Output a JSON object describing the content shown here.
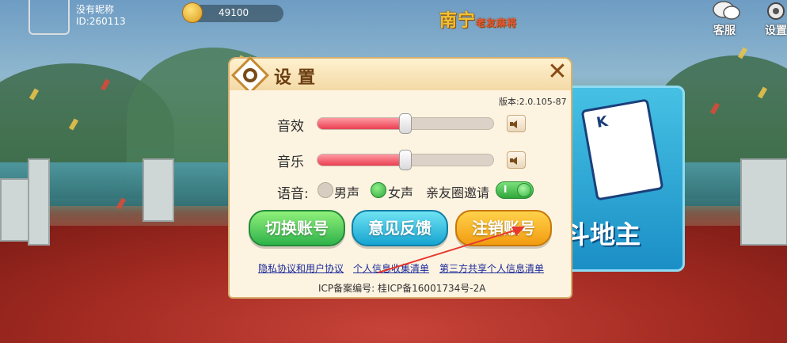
{
  "user": {
    "nickname": "没有昵称",
    "id_text": "ID:260113",
    "coins": "49100"
  },
  "header": {
    "logo_main": "南宁",
    "logo_sub": "老友麻将",
    "service_label": "客服",
    "settings_label": "设置"
  },
  "game_card": {
    "title": "斗地主",
    "card_rank": "K"
  },
  "dialog": {
    "title": "设置",
    "close_symbol": "✕",
    "version": "版本:2.0.105-87",
    "sound_effects_label": "音效",
    "sound_effects_level": 0.5,
    "music_label": "音乐",
    "music_level": 0.5,
    "voice_label": "语音:",
    "male_voice_label": "男声",
    "female_voice_label": "女声",
    "selected_voice": "女声",
    "friend_invite_label": "亲友圈邀请",
    "friend_invite_on": true,
    "toggle_text": "I",
    "buttons": {
      "switch_account": "切换账号",
      "feedback": "意见反馈",
      "cancel_account": "注销账号"
    },
    "links": {
      "privacy": "隐私协议和用户协议",
      "personal_info": "个人信息收集清单",
      "third_party": "第三方共享个人信息清单"
    },
    "icp": "ICP备案编号:  桂ICP备16001734号-2A"
  },
  "colors": {
    "slider_fill": "#ea3f52",
    "green_button": "#2fb34a",
    "blue_button": "#17a4d1",
    "orange_button": "#f29c12",
    "link": "#1b2b9a",
    "annotation_arrow": "#e8382e"
  }
}
